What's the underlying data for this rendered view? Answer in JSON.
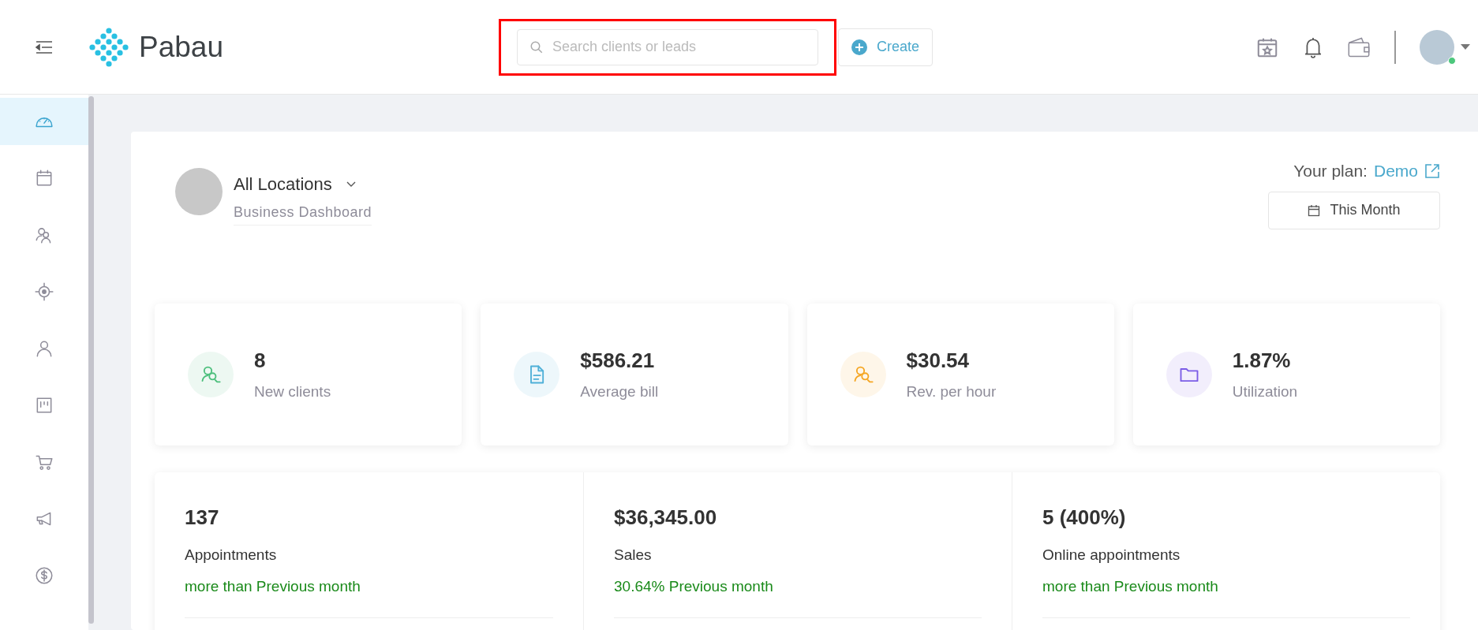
{
  "header": {
    "logo_text": "Pabau",
    "search": {
      "placeholder": "Search clients or leads"
    },
    "create_button": "Create",
    "user": {
      "online": true
    }
  },
  "sidebar": {
    "items": [
      {
        "selected": true
      },
      {
        "selected": false
      },
      {
        "selected": false
      },
      {
        "selected": false
      },
      {
        "selected": false
      },
      {
        "selected": false
      },
      {
        "selected": false
      },
      {
        "selected": false
      },
      {
        "selected": false
      }
    ]
  },
  "dashboard": {
    "location": "All Locations",
    "subtitle": "Business Dashboard",
    "plan_label": "Your plan:",
    "plan_name": "Demo",
    "period_button": "This Month",
    "stat_cards": [
      {
        "value": "8",
        "label": "New clients",
        "color": "#4cbf7c"
      },
      {
        "value": "$586.21",
        "label": "Average bill",
        "color": "#4fb0d8"
      },
      {
        "value": "$30.54",
        "label": "Rev. per hour",
        "color": "#f5a623"
      },
      {
        "value": "1.87%",
        "label": "Utilization",
        "color": "#7b5ce6"
      }
    ],
    "summary": [
      {
        "value": "137",
        "label": "Appointments",
        "change": "more than Previous month"
      },
      {
        "value": "$36,345.00",
        "label": "Sales",
        "change": "30.64% Previous month"
      },
      {
        "value": "5 (400%)",
        "label": "Online appointments",
        "change": "more than Previous month"
      }
    ]
  }
}
